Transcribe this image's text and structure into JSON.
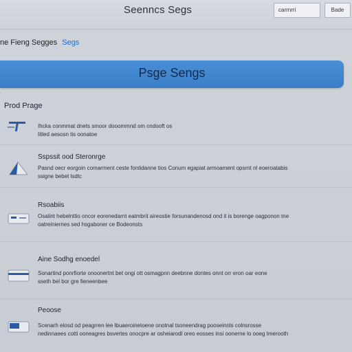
{
  "header": {
    "title": "Seenncs Segs",
    "search_value": "carrnrri",
    "button_label": "Bade"
  },
  "breadcrumb": {
    "parent": "ne Fieng Segges",
    "current": "Segs"
  },
  "banner": {
    "title": "Psge Sengs"
  },
  "section": {
    "label": "Prod Prage"
  },
  "rows": [
    {
      "title": "",
      "icon": "pen-icon",
      "line1": "Ihcka conmmat dnets smoor dooommnd om cndooft os",
      "line2": "Iitled aesosn tis oonatoe"
    },
    {
      "title": "Sspssit ood Steronrge",
      "icon": "triangle-icon",
      "line1": "Pasnd oecr eorgoin comarment ceste fontidanne tios Conum egapiat armoament opsrnt nl eoeroatabis",
      "line2": "ssigne bebet lsdtc"
    },
    {
      "title": "Rsoabiis",
      "icon": "tag-icon",
      "line1": "Osalint hebelnttio oncor eorenedarnt eatmbrit aireostie forsunandenosd ond it is borenge oagponon tne",
      "line2": "oatreiniernes sed hsgaboner ce Bodeonsts"
    },
    {
      "title": "Aine Sodhg enoedel",
      "icon": "card-icon",
      "line1": "Sonartind ponrfiorte onoonertnt bet ongi ott osmagpnn deebnne dontes onnt orr eron oar eone",
      "line2": "sseth bel bor gre fieneenbee"
    },
    {
      "title": "Peoose",
      "icon": "folder-icon",
      "line1": "Scenarh elosd od peagrren lee lbuaeroinetoene onotnal tsoneendrag pooseinnls colnsrosse",
      "line2": "nedinnaees cotti ooneagres bsvertes onocpre ar osheiarodl oreo eosses insi oonerne lo ooeg Imerooth"
    }
  ],
  "colors": {
    "accent": "#3f86cf",
    "link": "#1e6bc9",
    "background": "#cbd0d7"
  }
}
